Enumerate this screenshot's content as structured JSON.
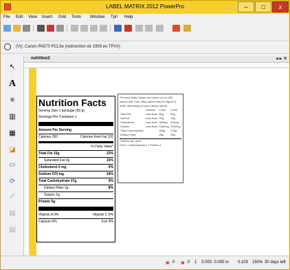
{
  "app": {
    "title": "LABEL MATRIX 2012 PowerPro",
    "controls": {
      "minimize": "–",
      "maximize": "□",
      "close": "x"
    }
  },
  "menu": [
    "File",
    "Edit",
    "View",
    "Insert",
    "Grid",
    "Tools",
    "Window",
    "Tpi!",
    "Help"
  ],
  "printer": {
    "text": "(VI): Canon PA570 PCL5e (redirection de 1959 en TPV#)"
  },
  "document": {
    "tab": "nutrition2"
  },
  "label": {
    "title": "Nutrition Facts",
    "serving_size": "Serving Size    1 package (50 g)",
    "servings_per_container": "Servings Per Container    1",
    "amount_per_serving": "Amount Per Serving",
    "calories_left": "Calories  250",
    "calories_right": "Calories from Fat  120",
    "daily_value_header": "% Daily Value*",
    "rows": [
      {
        "label": "Total Fat  15g",
        "value": "23%"
      },
      {
        "label": "Saturated Fat  3g",
        "value": "15%"
      },
      {
        "label": "Cholesterol  0 mg",
        "value": "0%"
      },
      {
        "label": "Sodium  570 mg",
        "value": "24%"
      },
      {
        "label": "Total Carbohydrate      27g",
        "value": "9%"
      },
      {
        "label": "Dietary Fiber  2g",
        "value": "8%"
      },
      {
        "label": "Sugars  1g",
        "value": ""
      },
      {
        "label": "Protein  5g",
        "value": ""
      }
    ],
    "vitamins": [
      {
        "left": "Vitamin A 0%",
        "right": "Vitamin C  0%"
      },
      {
        "left": "Calcium 0%",
        "right": "Iron  0%"
      }
    ]
  },
  "footnote": {
    "text": "*Percent Daily Values are based on a 2,000 calorie diet. Your daily values may be higher or lower depending on your calorie needs.",
    "header": [
      "",
      "Calories",
      "2,000",
      "2,500"
    ],
    "rows": [
      [
        "Total Fat",
        "Less than",
        "65g",
        "80g"
      ],
      [
        "Sat Fat",
        "Less than",
        "20g",
        "25g"
      ],
      [
        "Cholesterol",
        "Less than",
        "300mg",
        "300mg"
      ],
      [
        "Sodium",
        "Less than",
        "2400mg",
        "2400mg"
      ],
      [
        "Total Carbohydrate",
        "",
        "300g",
        "375g"
      ],
      [
        "Dietary Fiber",
        "",
        "25g",
        "30g"
      ]
    ],
    "cal_per_gram": "Calories per gram",
    "cal_per_gram_detail": "Fat 9  •  Carbohydrate 4  •  Protein 4"
  },
  "status": {
    "page": "0",
    "copies": "0",
    "count": "1",
    "coords": "3.000, 0.000 in",
    "size": "0.103",
    "zoom": "150%",
    "trial": "30 days left"
  }
}
